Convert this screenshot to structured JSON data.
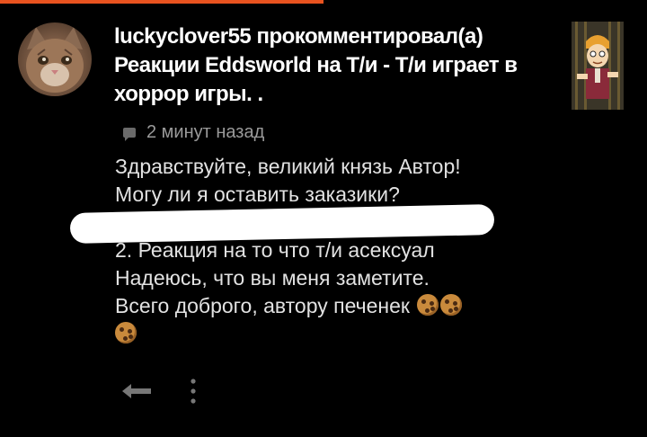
{
  "colors": {
    "accent_bar": "#e8531f",
    "background": "#000000"
  },
  "notification": {
    "author": "luckyclover55",
    "action": "прокомментировал(а)",
    "title": "Реакции Eddsworld на Т/и - Т/и играет в хоррор игры. .",
    "time_ago": "2 минут назад"
  },
  "comment": {
    "lines": [
      "Здравствуйте, великий князь Автор!",
      "Могу ли я оставить заказики?",
      "2. Реакция на то что т/и асексуал",
      "Надеюсь, что вы меня заметите.",
      "Всего доброго, автору печенек"
    ],
    "emoji": "cookie-emoji"
  },
  "icons": {
    "avatar": "cat-avatar",
    "thumbnail": "cartoon-character-thumbnail",
    "reply": "reply-icon",
    "more": "more-vertical-icon",
    "comment": "comment-icon"
  }
}
